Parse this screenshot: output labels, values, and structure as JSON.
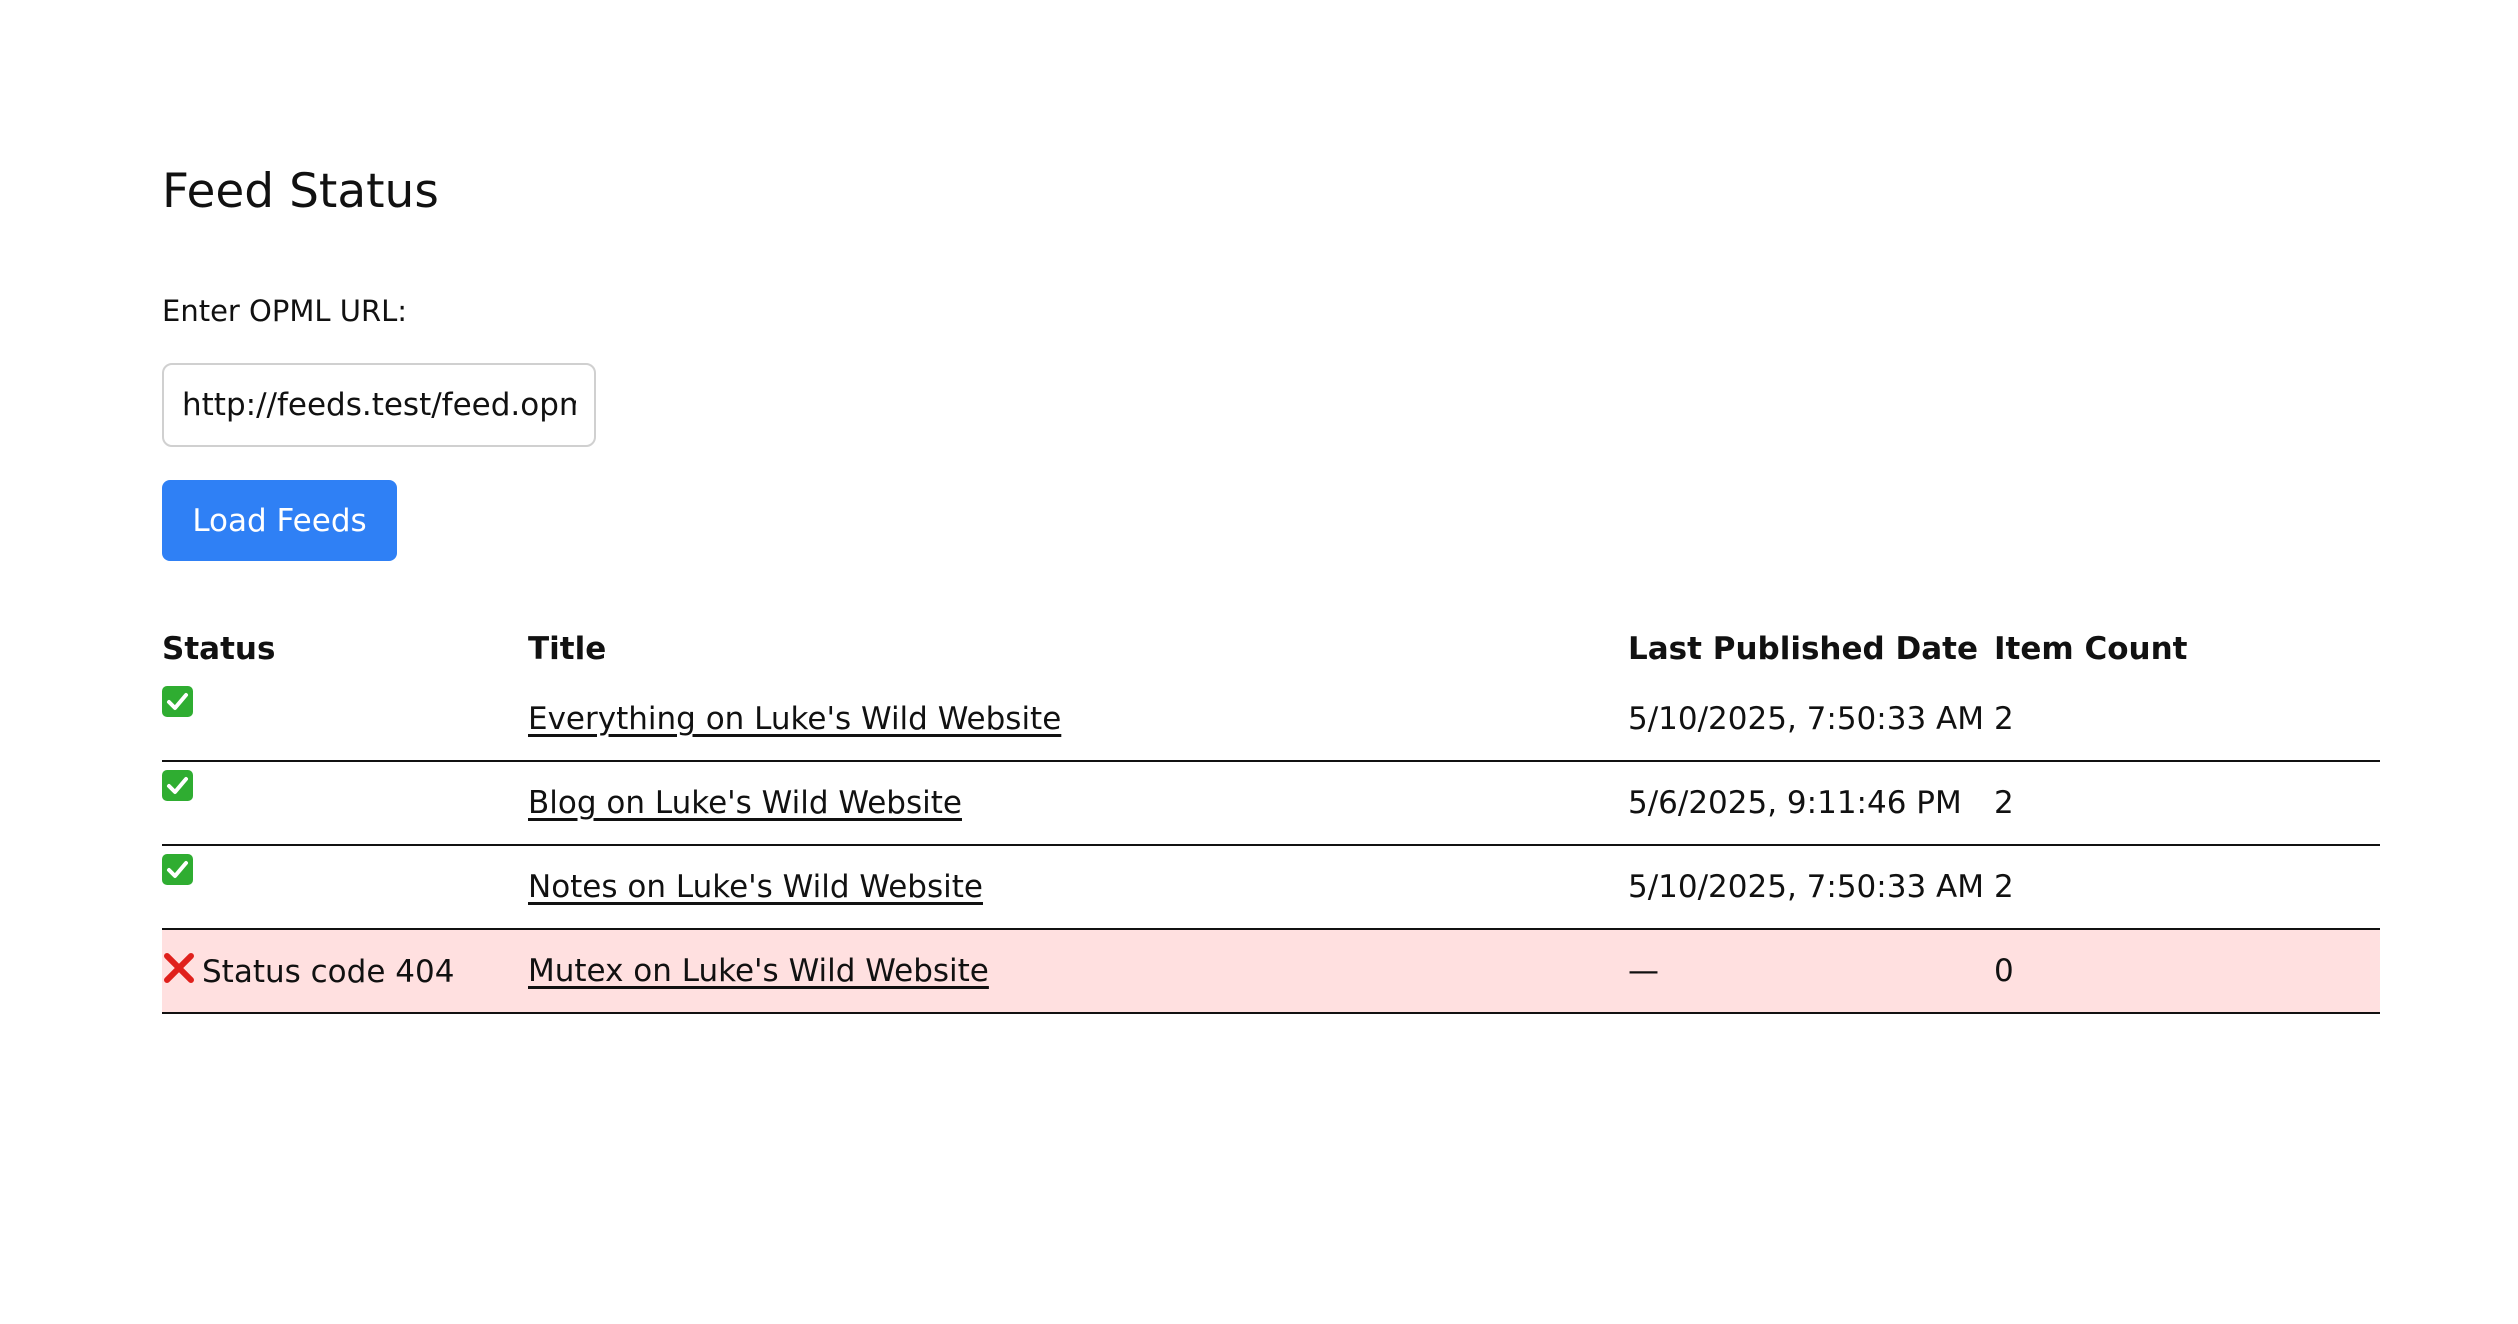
{
  "page": {
    "title": "Feed Status"
  },
  "form": {
    "label": "Enter OPML URL:",
    "url_value": "http://feeds.test/feed.opml",
    "load_button": "Load Feeds"
  },
  "table": {
    "headers": {
      "status": "Status",
      "title": "Title",
      "last_published": "Last Published Date",
      "item_count": "Item Count"
    },
    "rows": [
      {
        "status_icon": "check-mark-icon",
        "status_text": "",
        "title": "Everything on Luke's Wild Website",
        "last_published": "5/10/2025, 7:50:33 AM",
        "item_count": "2"
      },
      {
        "status_icon": "check-mark-icon",
        "status_text": "",
        "title": "Blog on Luke's Wild Website",
        "last_published": "5/6/2025, 9:11:46 PM",
        "item_count": "2"
      },
      {
        "status_icon": "check-mark-icon",
        "status_text": "",
        "title": "Notes on Luke's Wild Website",
        "last_published": "5/10/2025, 7:50:33 AM",
        "item_count": "2"
      },
      {
        "status_icon": "cross-mark-icon",
        "status_text": "Status code 404",
        "title": "Mutex on Luke's Wild Website",
        "last_published": "—",
        "item_count": "0"
      }
    ]
  },
  "colors": {
    "button_bg": "#2f80f5",
    "button_text": "#ffffff",
    "success_icon": "#2fad31",
    "error_icon": "#e0201c",
    "error_row_bg": "#ffe0e0",
    "row_border": "#111111"
  }
}
